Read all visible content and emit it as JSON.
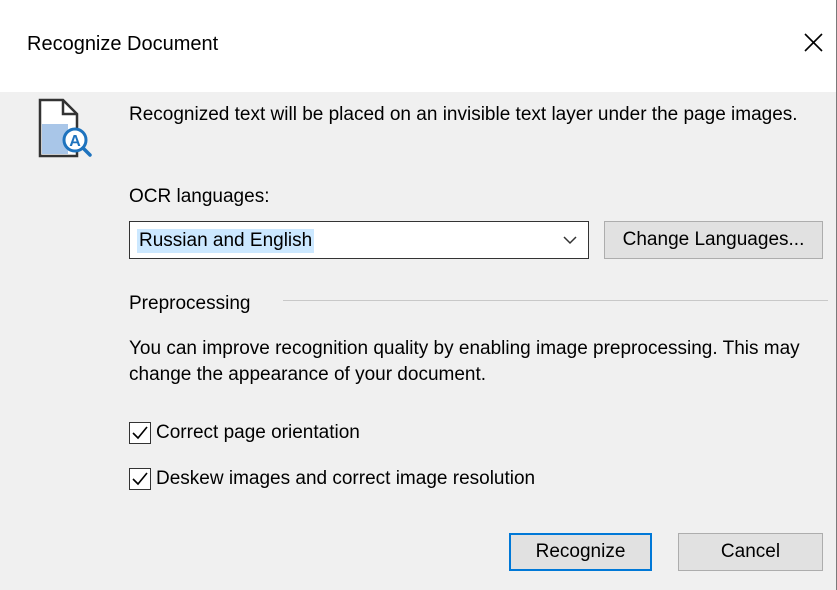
{
  "dialog": {
    "title": "Recognize Document",
    "close_icon": "close-icon"
  },
  "info": {
    "icon": "document-ocr-icon",
    "text": "Recognized text will be placed on an invisible text layer under the page images."
  },
  "ocr": {
    "label": "OCR languages:",
    "selected_language": "Russian and English",
    "change_button_label": "Change Languages..."
  },
  "preprocessing": {
    "group_label": "Preprocessing",
    "description": "You can improve recognition quality by enabling image preprocessing. This may change the appearance of your document.",
    "options": [
      {
        "label": "Correct page orientation",
        "checked": true
      },
      {
        "label": "Deskew images and correct image resolution",
        "checked": true
      }
    ]
  },
  "actions": {
    "recognize_label": "Recognize",
    "cancel_label": "Cancel"
  },
  "colors": {
    "accent": "#0078d7",
    "selection": "#cce8ff",
    "dialog_bg": "#f0f0f0",
    "icon_blue": "#1e73be"
  }
}
